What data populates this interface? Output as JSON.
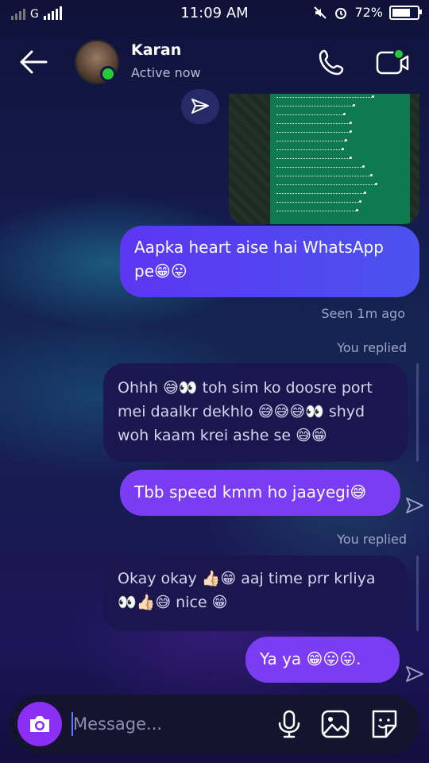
{
  "status_bar": {
    "network": "G",
    "time": "11:09 AM",
    "battery": "72%",
    "battery_level": 0.72
  },
  "header": {
    "contact_name": "Karan",
    "contact_status": "Active now",
    "icons": [
      "back-arrow-icon",
      "phone-icon",
      "video-call-icon"
    ]
  },
  "messages": [
    {
      "type": "sent",
      "text": "Aapka heart aise hai WhatsApp pe😁😛"
    },
    {
      "type": "meta",
      "text": "Seen 1m ago"
    },
    {
      "type": "meta",
      "text": "You replied"
    },
    {
      "type": "reply",
      "text": "Ohhh 😅👀 toh sim ko doosre port mei daalkr dekhlo 😅😅😅👀 shyd woh kaam krei ashe se 😅😁"
    },
    {
      "type": "sent",
      "text": "Tbb speed kmm ho jaayegi😅"
    },
    {
      "type": "meta",
      "text": "You replied"
    },
    {
      "type": "reply",
      "text": "Okay okay 👍🏻😁 aaj time prr krliya 👀👍🏻😅 nice 😁"
    },
    {
      "type": "sent",
      "text": "Ya ya 😁😛😛."
    }
  ],
  "composer": {
    "placeholder": "Message...",
    "accent": "#8b2ff5"
  },
  "colors": {
    "sent_bubble": "#5c36f2",
    "reply_bubble": "#1c164e",
    "online": "#25c93a"
  }
}
